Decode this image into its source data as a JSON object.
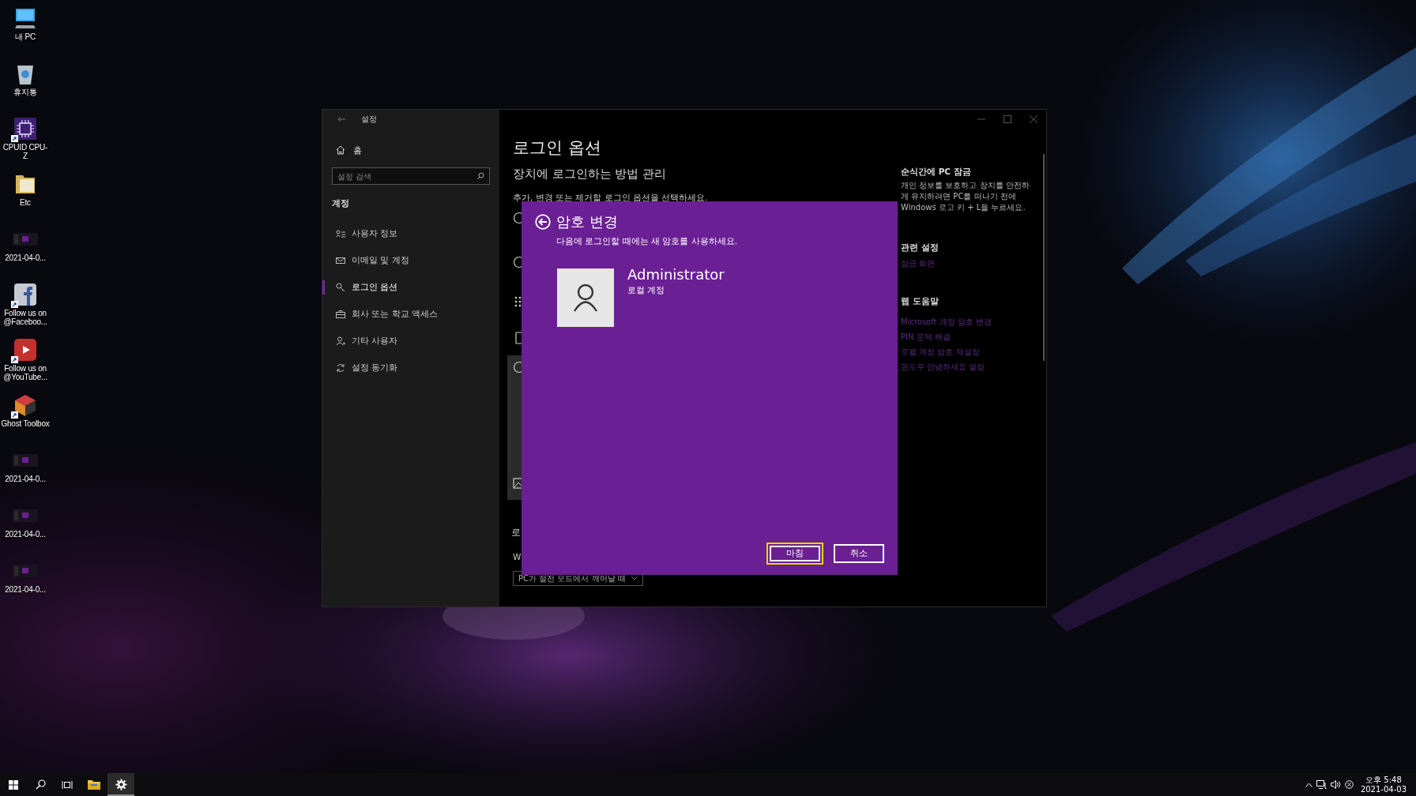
{
  "desktop_icons": [
    {
      "label": "내 PC",
      "kind": "computer",
      "shortcut": false
    },
    {
      "label": "휴지통",
      "kind": "recycle-bin",
      "shortcut": false
    },
    {
      "label": "CPUID CPU-Z",
      "kind": "chip",
      "shortcut": true
    },
    {
      "label": "Etc",
      "kind": "folder",
      "shortcut": false
    },
    {
      "label": "2021-04-0...",
      "kind": "screenshot",
      "shortcut": false
    },
    {
      "label": "Follow us on @Faceboo...",
      "kind": "facebook",
      "shortcut": true
    },
    {
      "label": "Follow us on @YouTube...",
      "kind": "video",
      "shortcut": true
    },
    {
      "label": "Ghost Toolbox",
      "kind": "cube",
      "shortcut": true
    },
    {
      "label": "2021-04-0...",
      "kind": "screenshot",
      "shortcut": false
    },
    {
      "label": "2021-04-0...",
      "kind": "screenshot",
      "shortcut": false
    },
    {
      "label": "2021-04-0...",
      "kind": "screenshot",
      "shortcut": false
    }
  ],
  "settings_window": {
    "title": "설정",
    "home": "홈",
    "search": {
      "placeholder": "설정 검색"
    },
    "section": "계정",
    "nav_items": [
      {
        "label": "사용자 정보",
        "kind": "user-info",
        "selected": false
      },
      {
        "label": "이메일 및 계정",
        "kind": "mail",
        "selected": false
      },
      {
        "label": "로그인 옵션",
        "kind": "key",
        "selected": true
      },
      {
        "label": "회사 또는 학교 액세스",
        "kind": "briefcase",
        "selected": false
      },
      {
        "label": "기타 사용자",
        "kind": "person",
        "selected": false
      },
      {
        "label": "설정 동기화",
        "kind": "sync",
        "selected": false
      }
    ],
    "page": {
      "title": "로그인 옵션",
      "subtitle": "장치에 로그인하는 방법 관리",
      "hint": "추가, 변경 또는 제거할 로그인 옵션을 선택하세요.",
      "section_cut": "로",
      "label_cut": "W",
      "dropdown": {
        "value": "PC가 절전 모드에서 깨어날 때"
      }
    },
    "side_panel": [
      {
        "heading": "순식간에 PC 잠금",
        "text": "개인 정보를 보호하고 장치를 안전하게 유지하려면 PC를 떠나기 전에 Windows 로고 키 + L을 누르세요."
      },
      {
        "heading": "관련 설정",
        "links": [
          "잠금 화면"
        ]
      },
      {
        "heading": "웹 도움말",
        "links": [
          "Microsoft 계정 암호 변경",
          "PIN 문제 해결",
          "로컬 계정 암호 재설정",
          "윈도우 안녕하세요 설정"
        ]
      }
    ]
  },
  "dialog": {
    "title": "암호 변경",
    "subtitle": "다음에 로그인할 때에는 새 암호를 사용하세요.",
    "account": {
      "name": "Administrator",
      "type": "로컬 계정"
    },
    "buttons": [
      {
        "label": "마침",
        "focused": true
      },
      {
        "label": "취소",
        "focused": false
      }
    ]
  },
  "taskbar": {
    "apps": [
      {
        "kind": "start",
        "selected": false
      },
      {
        "kind": "search",
        "selected": false
      },
      {
        "kind": "task-view",
        "selected": false
      },
      {
        "kind": "explorer",
        "selected": false
      },
      {
        "kind": "settings",
        "selected": true
      }
    ],
    "clock": {
      "time": "오후 5:48",
      "date": "2021-04-03"
    }
  }
}
